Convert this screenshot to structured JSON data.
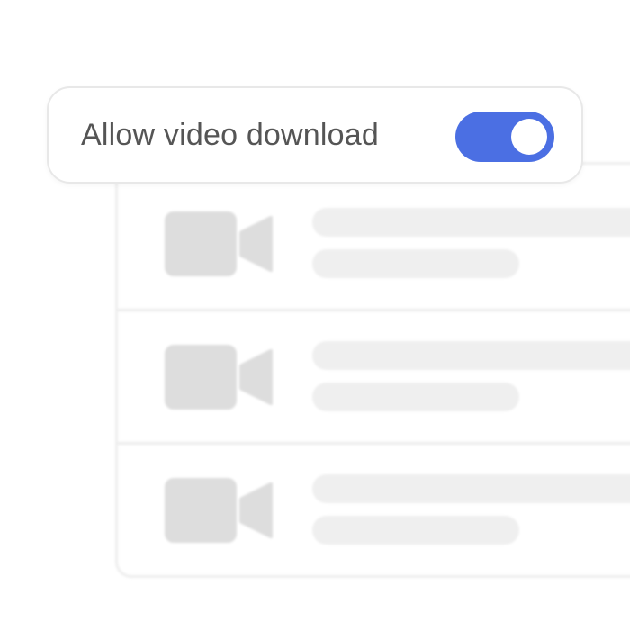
{
  "setting": {
    "label": "Allow video download",
    "enabled": true
  },
  "colors": {
    "accent": "#4b6fe3",
    "label_text": "#555555",
    "placeholder": "#efefef",
    "icon": "#dddddd"
  },
  "list": {
    "items": [
      {
        "icon": "video-camera-icon"
      },
      {
        "icon": "video-camera-icon"
      },
      {
        "icon": "video-camera-icon"
      }
    ]
  }
}
